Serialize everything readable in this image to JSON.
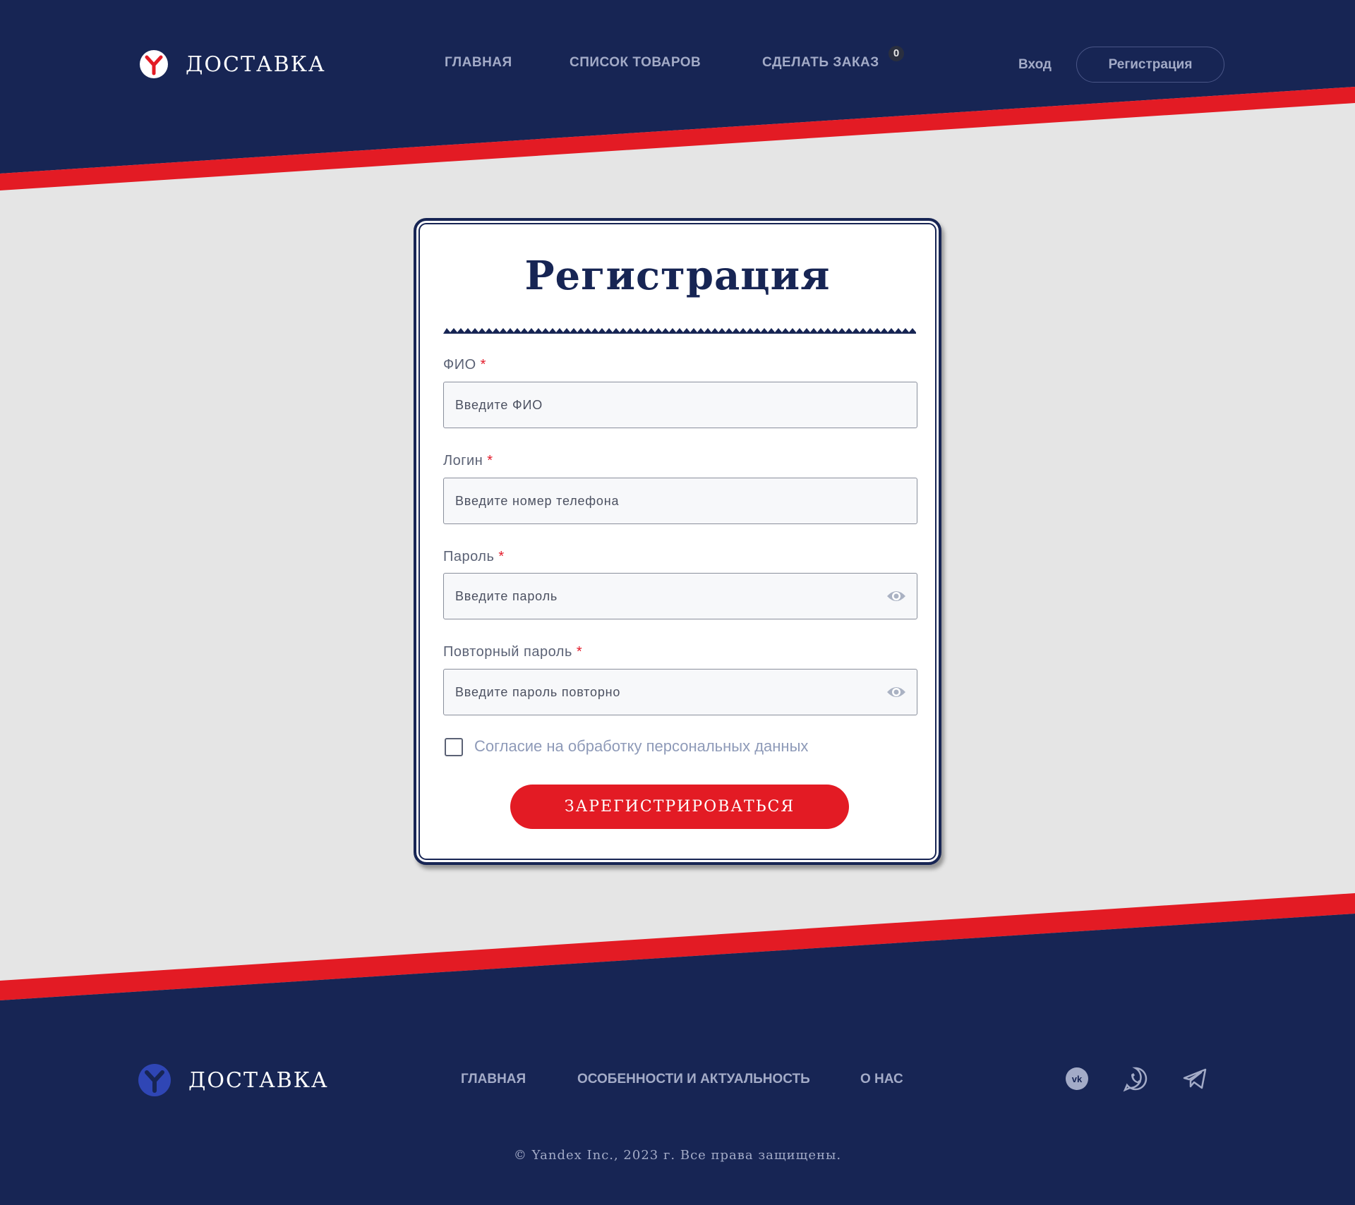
{
  "colors": {
    "navy": "#172554",
    "red": "#e31b24",
    "light_bg": "#e5e5e5",
    "nav_text": "#a3abc7"
  },
  "header": {
    "logo_text": "ДОСТАВКА",
    "nav": [
      "ГЛАВНАЯ",
      "СПИСОК ТОВАРОВ",
      "СДЕЛАТЬ ЗАКАЗ"
    ],
    "cart_count": "0",
    "login_label": "Вход",
    "register_label": "Регистрация"
  },
  "form": {
    "title": "Регистрация",
    "required_mark": "*",
    "fields": [
      {
        "label": "ФИО",
        "placeholder": "Введите ФИО"
      },
      {
        "label": "Логин",
        "placeholder": "Введите номер телефона"
      },
      {
        "label": "Пароль",
        "placeholder": "Введите пароль",
        "icon": "eye-icon"
      },
      {
        "label": "Повторный пароль",
        "placeholder": "Введите пароль повторно",
        "icon": "eye-icon"
      }
    ],
    "consent_label": "Согласие на обработку персональных данных",
    "consent_checked": false,
    "submit_label": "ЗАРЕГИСТРИРОВАТЬСЯ"
  },
  "footer": {
    "logo_text": "ДОСТАВКА",
    "nav": [
      "ГЛАВНАЯ",
      "ОСОБЕННОСТИ И АКТУАЛЬНОСТЬ",
      "О НАС"
    ],
    "social": [
      "vk-icon",
      "whatsapp-icon",
      "telegram-icon"
    ],
    "copyright": "© Yandex Inc., 2023 г. Все права защищены."
  }
}
